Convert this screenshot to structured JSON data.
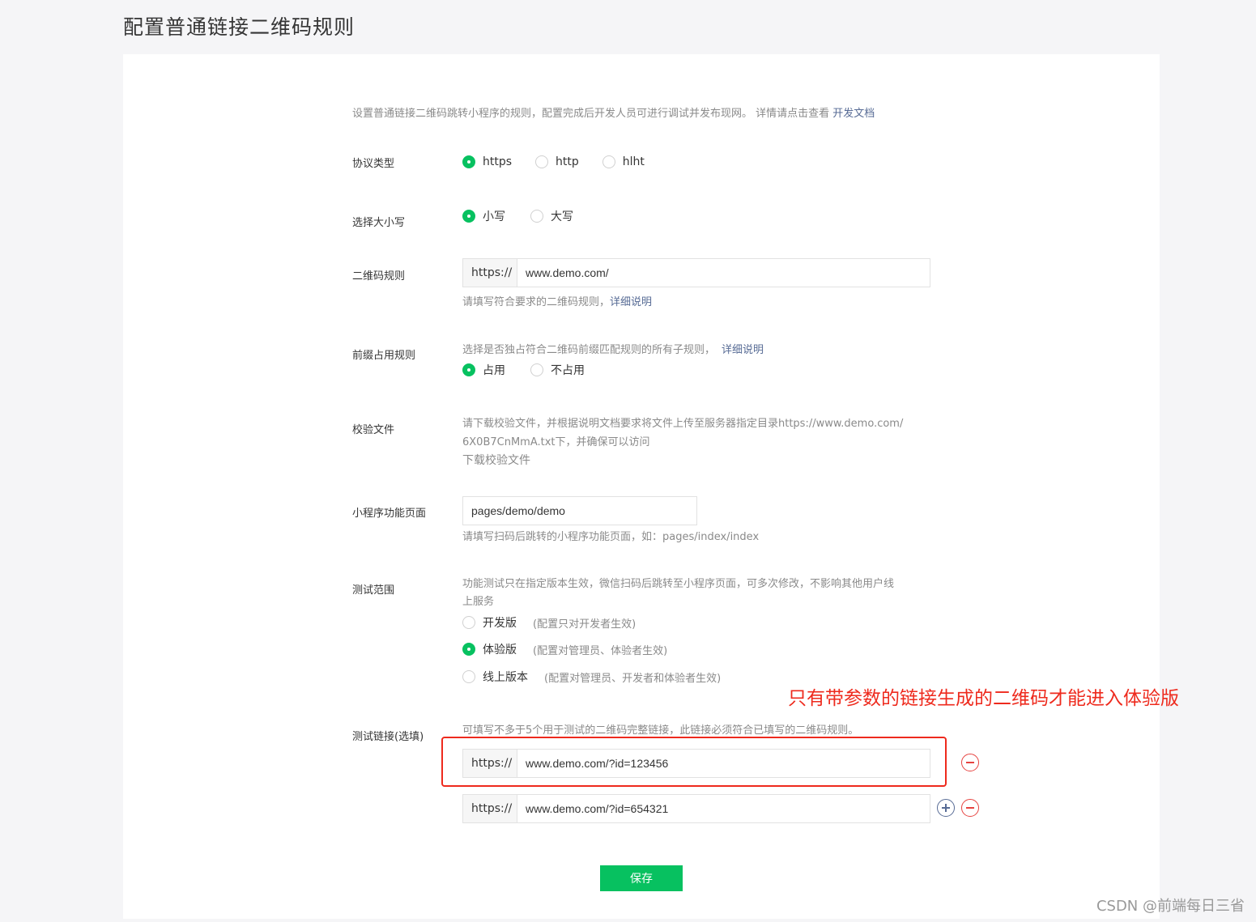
{
  "page": {
    "title": "配置普通链接二维码规则"
  },
  "intro": {
    "text": "设置普通链接二维码跳转小程序的规则，配置完成后开发人员可进行调试并发布现网。 详情请点击查看 ",
    "link": "开发文档"
  },
  "protocol": {
    "label": "协议类型",
    "options": [
      {
        "label": "https",
        "checked": true
      },
      {
        "label": "http",
        "checked": false
      },
      {
        "label": "hlht",
        "checked": false
      }
    ]
  },
  "case": {
    "label": "选择大小写",
    "options": [
      {
        "label": "小写",
        "checked": true
      },
      {
        "label": "大写",
        "checked": false
      }
    ]
  },
  "qr_rule": {
    "label": "二维码规则",
    "prefix": "https://",
    "value": "www.demo.com/",
    "hint": "请填写符合要求的二维码规则，",
    "hint_link": "详细说明"
  },
  "prefix_rule": {
    "label": "前缀占用规则",
    "hint": "选择是否独占符合二维码前缀匹配规则的所有子规则，",
    "hint_link": "详细说明",
    "options": [
      {
        "label": "占用",
        "checked": true
      },
      {
        "label": "不占用",
        "checked": false
      }
    ]
  },
  "verify_file": {
    "label": "校验文件",
    "hint_line1": "请下载校验文件，并根据说明文档要求将文件上传至服务器指定目录https://www.demo.com/",
    "hint_line2": "6X0B7CnMmA.txt下，并确保可以访问",
    "download_link": "下载校验文件"
  },
  "mp_page": {
    "label": "小程序功能页面",
    "value": "pages/demo/demo",
    "hint": "请填写扫码后跳转的小程序功能页面，如：pages/index/index"
  },
  "test_scope": {
    "label": "测试范围",
    "hint_line1": "功能测试只在指定版本生效，微信扫码后跳转至小程序页面，可多次修改，不影响其他用户线",
    "hint_line2": "上服务",
    "options": [
      {
        "label": "开发版",
        "note": "(配置只对开发者生效)",
        "checked": false
      },
      {
        "label": "体验版",
        "note": "(配置对管理员、体验者生效)",
        "checked": true
      },
      {
        "label": "线上版本",
        "note": "(配置对管理员、开发者和体验者生效)",
        "checked": false
      }
    ]
  },
  "test_links": {
    "label": "测试链接(选填)",
    "hint": "可填写不多于5个用于测试的二维码完整链接，此链接必须符合已填写的二维码规则。",
    "items": [
      {
        "prefix": "https://",
        "value": "www.demo.com/?id=123456"
      },
      {
        "prefix": "https://",
        "value": "www.demo.com/?id=654321"
      }
    ]
  },
  "save_label": "保存",
  "annotation": "只有带参数的链接生成的二维码才能进入体验版",
  "watermark": "CSDN @前端每日三省",
  "colors": {
    "accent_green": "#07c160",
    "link_blue": "#576b95",
    "annotation_red": "#ee2a1d",
    "minus_red": "#e64340"
  }
}
